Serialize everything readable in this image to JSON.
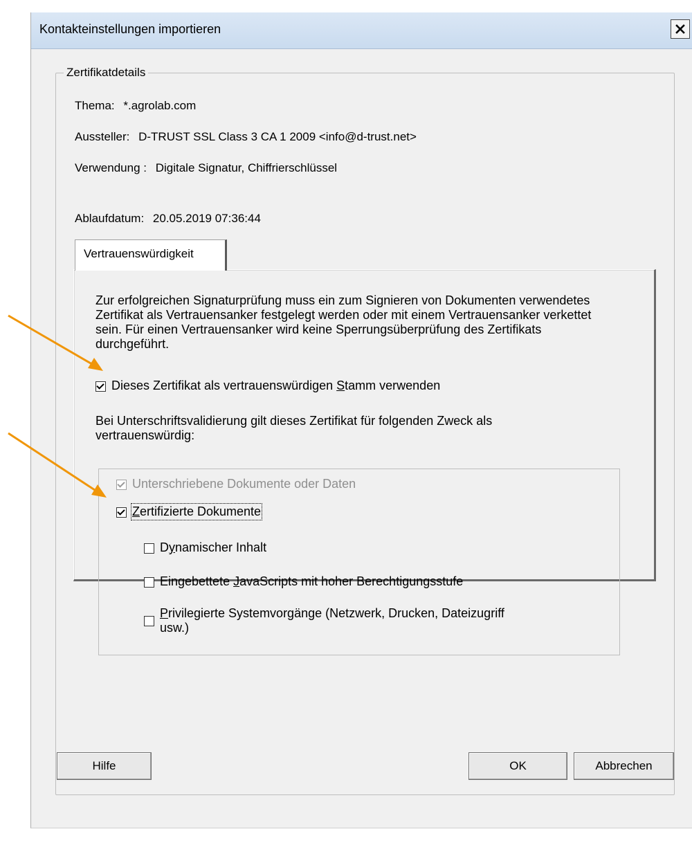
{
  "dialog": {
    "title": "Kontakteinstellungen importieren",
    "close_symbol": "✕"
  },
  "details": {
    "group_label": "Zertifikatdetails",
    "subject_label": "Thema:",
    "subject_value": "*.agrolab.com",
    "issuer_label": "Aussteller:",
    "issuer_value": "D-TRUST SSL Class 3 CA 1 2009 <info@d-trust.net>",
    "usage_label": "Verwendung :",
    "usage_value": "Digitale Signatur, Chiffrierschlüssel",
    "expiry_label": "Ablaufdatum:",
    "expiry_value": "20.05.2019 07:36:44"
  },
  "tab": {
    "label": "Vertrauenswürdigkeit"
  },
  "trust": {
    "description": "Zur erfolgreichen Signaturprüfung muss ein zum Signieren von Dokumenten verwendetes Zertifikat als Vertrauensanker festgelegt werden oder mit einem Vertrauensanker verkettet sein. Für einen Vertrauensanker wird keine Sperrungsüberprüfung des Zertifikats durchgeführt.",
    "root_checkbox_label_before": "Dieses Zertifikat als vertrauenswürdigen ",
    "root_checkbox_mnemonic": "S",
    "root_checkbox_label_after": "tamm verwenden",
    "root_checked": true,
    "purpose_description": "Bei Unterschriftsvalidierung gilt dieses Zertifikat für folgenden Zweck als vertrauenswürdig:"
  },
  "purposes": {
    "signed_docs_label": "Unterschriebene Dokumente oder Daten",
    "signed_docs_checked": true,
    "signed_docs_enabled": false,
    "certified_docs_mnemonic": "Z",
    "certified_docs_label_after": "ertifizierte Dokumente",
    "certified_docs_checked": true,
    "dynamic_label_before": "D",
    "dynamic_mnemonic": "y",
    "dynamic_label_after": "namischer Inhalt",
    "dynamic_checked": false,
    "js_label_before": "Eingebettete ",
    "js_mnemonic": "J",
    "js_label_after": "avaScripts mit hoher Berechtigungsstufe",
    "js_checked": false,
    "privileged_mnemonic": "P",
    "privileged_label_after": "rivilegierte Systemvorgänge (Netzwerk, Drucken, Dateizugriff",
    "privileged_label_line2": "usw.)",
    "privileged_checked": false
  },
  "buttons": {
    "help": "Hilfe",
    "ok": "OK",
    "cancel": "Abbrechen"
  },
  "colors": {
    "annotation_arrow": "#f0960a",
    "dialog_background": "#f0f0f0",
    "titlebar": "#c9dbef"
  }
}
